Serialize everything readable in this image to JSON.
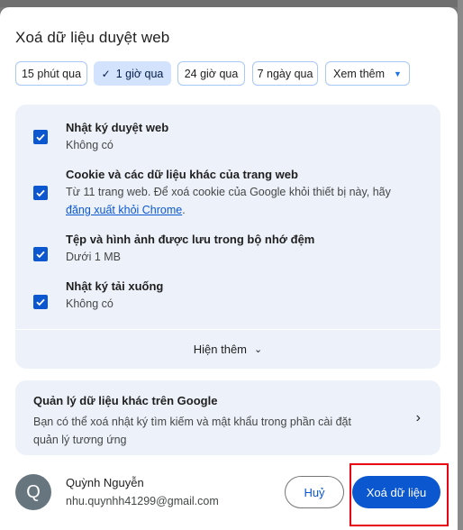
{
  "dialog": {
    "title": "Xoá dữ liệu duyệt web"
  },
  "time_ranges": [
    {
      "label": "15 phút qua",
      "selected": false
    },
    {
      "label": "1 giờ qua",
      "selected": true
    },
    {
      "label": "24 giờ qua",
      "selected": false
    },
    {
      "label": "7 ngày qua",
      "selected": false
    },
    {
      "label": "Xem thêm",
      "selected": false
    }
  ],
  "items": [
    {
      "title": "Nhật ký duyệt web",
      "subtitle": "Không có",
      "checked": true
    },
    {
      "title": "Cookie và các dữ liệu khác của trang web",
      "subtitle": "Từ 11 trang web. Để xoá cookie của Google khỏi thiết bị này, hãy",
      "link": "đăng xuất khỏi Chrome",
      "link_suffix": ".",
      "checked": true
    },
    {
      "title": "Tệp và hình ảnh được lưu trong bộ nhớ đệm",
      "subtitle": "Dưới 1 MB",
      "checked": true
    },
    {
      "title": "Nhật ký tải xuống",
      "subtitle": "Không có",
      "checked": true
    }
  ],
  "show_more": "Hiện thêm",
  "manage": {
    "title": "Quản lý dữ liệu khác trên Google",
    "description": "Bạn có thể xoá nhật ký tìm kiếm và mật khẩu trong phần cài đặt quản lý tương ứng"
  },
  "account": {
    "initial": "Q",
    "name": "Quỳnh Nguyễn",
    "email": "nhu.quynhh41299@gmail.com"
  },
  "buttons": {
    "cancel": "Huỷ",
    "clear": "Xoá dữ liệu"
  },
  "colors": {
    "accent": "#0b57d0",
    "panel": "#edf2fa",
    "highlight": "#e60012"
  }
}
